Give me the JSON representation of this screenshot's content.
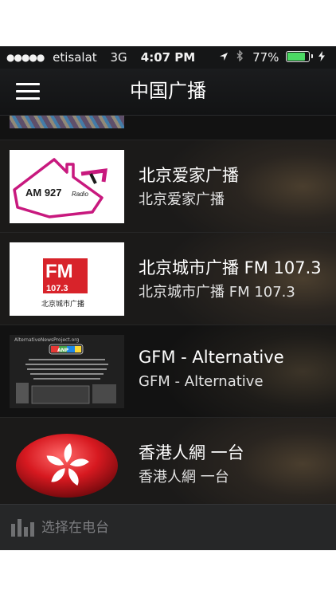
{
  "status_bar": {
    "signal": "●●●●●",
    "carrier": "etisalat",
    "network": "3G",
    "time": "4:07 PM",
    "battery": "77%",
    "battery_level": 0.77,
    "icons": [
      "location-arrow-icon",
      "bluetooth-icon",
      "charging-bolt-icon"
    ]
  },
  "nav": {
    "title": "中国广播",
    "menu_icon": "hamburger-menu-icon"
  },
  "stations": [
    {
      "title": "北京爱家广播",
      "subtitle": "北京爱家广播",
      "logo_text": "AM 927",
      "logo_suffix": "Radio"
    },
    {
      "title": "北京城市广播 FM 107.3",
      "subtitle": "北京城市广播 FM 107.3",
      "logo_text": "FM",
      "logo_number": "107.3",
      "logo_caption": "北京城市广播"
    },
    {
      "title": "GFM - Alternative",
      "subtitle": "GFM - Alternative",
      "logo_text": "AlternativeNewsProject.org",
      "logo_badge": "ANP"
    },
    {
      "title": "香港人網 一台",
      "subtitle": "香港人網 一台"
    }
  ],
  "bottom_bar": {
    "label": "选择在电台",
    "icon": "equalizer-icon"
  },
  "colors": {
    "nav_background": "#1b1c1e",
    "list_background": "#1b1a19",
    "bottom_background": "#262728",
    "battery_green": "#4cd964",
    "am_logo_pink": "#c8197e",
    "fm_logo_red": "#d8232a",
    "hk_flag_red": "#d71920"
  }
}
